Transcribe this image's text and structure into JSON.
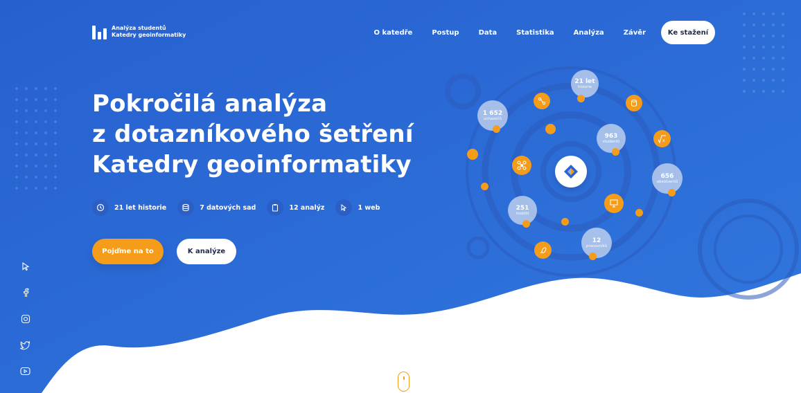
{
  "logo": {
    "line1": "Analýza studentů",
    "line2": "Katedry geoinformatiky"
  },
  "nav": {
    "items": [
      {
        "label": "O katedře"
      },
      {
        "label": "Postup"
      },
      {
        "label": "Data"
      },
      {
        "label": "Statistika"
      },
      {
        "label": "Analýza"
      },
      {
        "label": "Závěr"
      }
    ],
    "download_label": "Ke stažení"
  },
  "hero": {
    "title_lines": [
      "Pokročilá analýza",
      "z dotazníkového šetření",
      "Katedry geoinformatiky"
    ],
    "stats": [
      {
        "label": "21 let historie",
        "icon": "history-icon"
      },
      {
        "label": "7 datových sad",
        "icon": "database-icon"
      },
      {
        "label": "12 analýz",
        "icon": "clipboard-icon"
      },
      {
        "label": "1 web",
        "icon": "cursor-icon"
      }
    ],
    "primary_button": "Pojďme na to",
    "secondary_button": "K analýze"
  },
  "orbit": {
    "bubbles": [
      {
        "value": "21 let",
        "caption": "historie"
      },
      {
        "value": "1 652",
        "caption": "uchazečů"
      },
      {
        "value": "963",
        "caption": "studentů"
      },
      {
        "value": "656",
        "caption": "absolventů"
      },
      {
        "value": "251",
        "caption": "mobilit"
      },
      {
        "value": "12",
        "caption": "pracovníků"
      }
    ]
  },
  "social": [
    "cursor-icon",
    "facebook-icon",
    "instagram-icon",
    "twitter-icon",
    "youtube-icon"
  ],
  "colors": {
    "hero_blue": "#2a63d1",
    "accent_orange": "#f59c1b",
    "white": "#ffffff",
    "dark_text": "#1e2a4a"
  }
}
